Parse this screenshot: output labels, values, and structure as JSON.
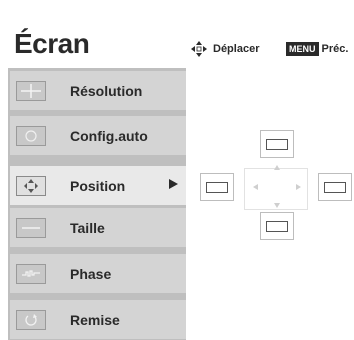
{
  "header": {
    "title": "Écran",
    "move_label": "Déplacer",
    "menu_key": "MENU",
    "back_label": "Préc."
  },
  "icons": {
    "move": "four-way-arrows-icon",
    "resolution": "resolution-grid-icon",
    "autoconfig": "autoconfig-circle-icon",
    "position": "position-arrows-icon",
    "size": "size-line-icon",
    "phase": "phase-wave-icon",
    "reset": "reset-circular-icon"
  },
  "menu": {
    "items": [
      {
        "label": "Résolution"
      },
      {
        "label": "Config.auto"
      },
      {
        "label": "Position",
        "selected": true
      },
      {
        "label": "Taille"
      },
      {
        "label": "Phase"
      },
      {
        "label": "Remise"
      }
    ]
  },
  "colors": {
    "text": "#2a2a2a",
    "menu_panel": "#bfbfbf",
    "menu_item": "#d4d4d4",
    "menu_item_selected": "#e9e9e9"
  }
}
